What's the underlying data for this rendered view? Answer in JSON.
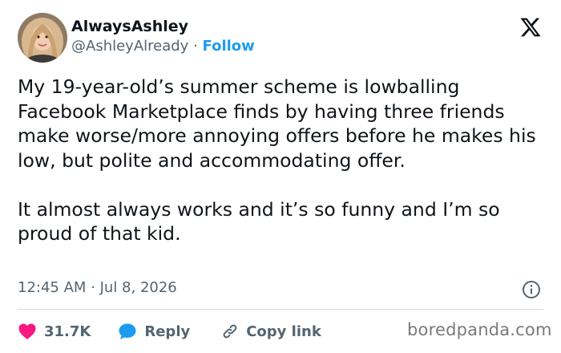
{
  "author": {
    "display_name": "AlwaysAshley",
    "handle": "@AshleyAlready",
    "separator": " · ",
    "follow_label": "Follow"
  },
  "tweet": {
    "paragraph1": "My 19-year-old’s summer scheme is lowballing Facebook Marketplace finds by having three friends make worse/more annoying offers before he makes his low, but polite and accommodating offer.",
    "paragraph2": "It almost always works and it’s so funny and I’m so proud of that kid.",
    "timestamp": "12:45 AM · Jul 8, 2026"
  },
  "actions": {
    "like_count": "31.7K",
    "reply_label": "Reply",
    "copy_link_label": "Copy link"
  },
  "watermark": "boredpanda.com",
  "icons": {
    "logo": "x-logo-icon",
    "info": "info-icon",
    "like": "heart-icon",
    "reply": "speech-bubble-icon",
    "copy": "link-icon"
  },
  "colors": {
    "accent": "#1d9bf0",
    "like": "#f91880",
    "text": "#0f1419",
    "muted": "#536471",
    "divider": "#cfd9de"
  }
}
